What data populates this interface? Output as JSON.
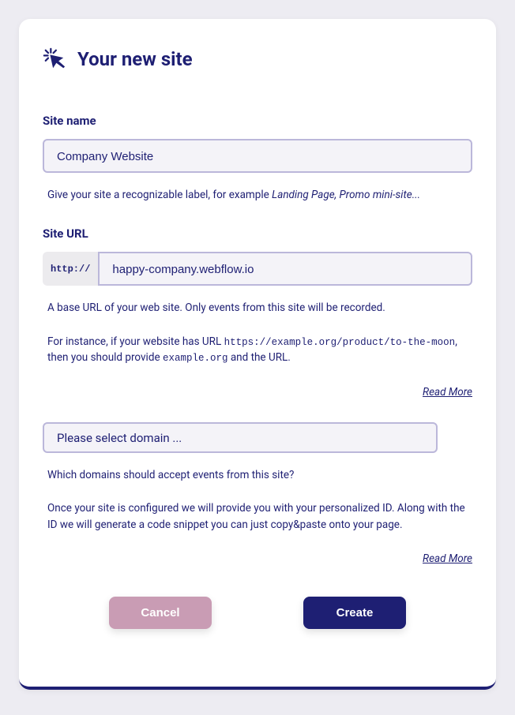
{
  "header": {
    "title": "Your new site"
  },
  "siteName": {
    "label": "Site name",
    "value": "Company Website",
    "hint_prefix": "Give your site a recognizable label, for example ",
    "hint_em": "Landing Page, Promo mini-site..."
  },
  "siteUrl": {
    "label": "Site URL",
    "prefix": "http://",
    "value": "happy-company.webflow.io",
    "hint1": "A base URL of your web site. Only events from this site will be recorded.",
    "hint2_a": "For instance, if your website has URL ",
    "hint2_code1": "https://example.org/product/to-the-moon",
    "hint2_b": ", then you should provide ",
    "hint2_code2": "example.org",
    "hint2_c": " and the URL.",
    "readMore": "Read More"
  },
  "domain": {
    "placeholder": "Please select domain ...",
    "hint1": "Which domains should accept events from this site?",
    "hint2": "Once your site is configured we will provide you with your personalized ID. Along with the ID we will generate a code snippet you can just copy&paste onto your page.",
    "readMore": "Read More"
  },
  "buttons": {
    "cancel": "Cancel",
    "create": "Create"
  }
}
